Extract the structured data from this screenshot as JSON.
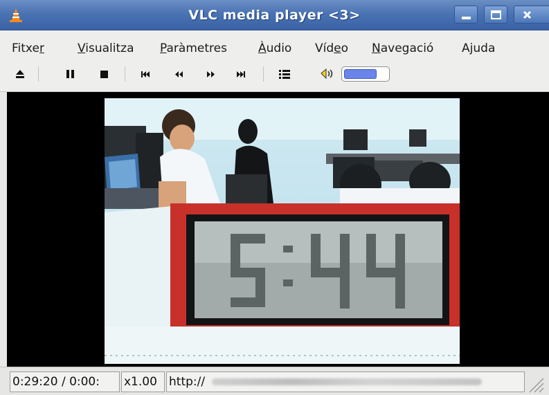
{
  "window": {
    "title": "VLC media player <3>"
  },
  "menu": {
    "items": [
      {
        "pre": "Fitxe",
        "key": "r",
        "post": ""
      },
      {
        "pre": "",
        "key": "V",
        "post": "isualitza"
      },
      {
        "pre": "",
        "key": "P",
        "post": "aràmetres"
      },
      {
        "pre": "",
        "key": "À",
        "post": "udio"
      },
      {
        "pre": "Víd",
        "key": "e",
        "post": "o"
      },
      {
        "pre": "",
        "key": "N",
        "post": "avegació"
      },
      {
        "pre": "A",
        "key": "j",
        "post": "uda"
      }
    ]
  },
  "toolbar": {
    "buttons": [
      "eject-icon",
      "pause-icon",
      "stop-icon",
      "skip-previous-icon",
      "rewind-icon",
      "fast-forward-icon",
      "skip-next-icon",
      "playlist-icon",
      "volume-icon"
    ],
    "volume_level": 0.75
  },
  "video": {
    "clock_display": "5:44"
  },
  "status": {
    "time": "0:29:20 / 0:00:",
    "speed": "x1.00",
    "url": "http://"
  },
  "colors": {
    "titlebar": "#4a73b3",
    "clock_frame": "#c8302a",
    "volume_fill": "#6b84e8"
  }
}
